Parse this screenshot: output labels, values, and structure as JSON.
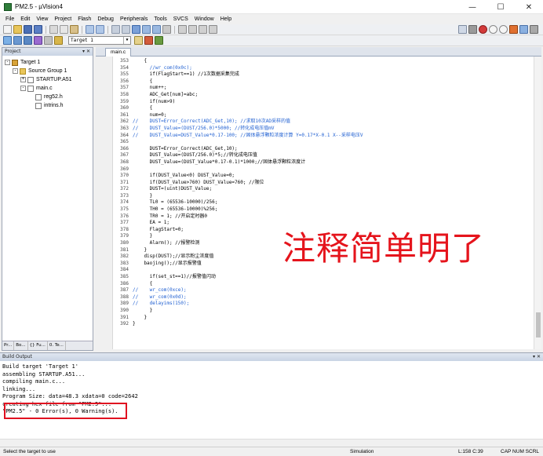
{
  "window": {
    "title": "PM2.5 - µVision4",
    "controls": [
      "—",
      "☐",
      "✕"
    ]
  },
  "menu": [
    "File",
    "Edit",
    "View",
    "Project",
    "Flash",
    "Debug",
    "Peripherals",
    "Tools",
    "SVCS",
    "Window",
    "Help"
  ],
  "toolbar": {
    "target_select": "Target 1"
  },
  "project_panel": {
    "title": "Project",
    "tree": [
      {
        "label": "Target 1",
        "level": 0,
        "kind": "target",
        "expand": "-"
      },
      {
        "label": "Source Group 1",
        "level": 1,
        "kind": "folder",
        "expand": "-"
      },
      {
        "label": "STARTUP.A51",
        "level": 2,
        "kind": "file",
        "expand": "+"
      },
      {
        "label": "main.c",
        "level": 2,
        "kind": "file",
        "expand": "-"
      },
      {
        "label": "reg52.h",
        "level": 3,
        "kind": "file",
        "expand": ""
      },
      {
        "label": "intrins.h",
        "level": 3,
        "kind": "file",
        "expand": ""
      }
    ],
    "tabs": [
      "Pr...",
      "Bo...",
      "{} Fu...",
      "0. Te..."
    ]
  },
  "editor": {
    "tab": "main.c",
    "lines": [
      {
        "n": "353",
        "code": "    {"
      },
      {
        "n": "354",
        "code": "      //wr_com(0x0c);"
      },
      {
        "n": "355",
        "code": "      if(FlagStart==1) //1次数据采集完成"
      },
      {
        "n": "356",
        "code": "      {"
      },
      {
        "n": "357",
        "code": "      num++;"
      },
      {
        "n": "358",
        "code": "      ADC_Get[num]=abc;"
      },
      {
        "n": "359",
        "code": "      if(num>9)"
      },
      {
        "n": "360",
        "code": "      {"
      },
      {
        "n": "361",
        "code": "      num=0;"
      },
      {
        "n": "362",
        "code": "//    DUST=Error_Correct(ADC_Get,10); //求取10次AD采样的值"
      },
      {
        "n": "363",
        "code": "//    DUST_Value=(DUST/256.0)*5000; //转化成电压值mV"
      },
      {
        "n": "364",
        "code": "//    DUST_Value=DUST_Value*0.17-100; //固体悬浮颗粒浓度计算 Y=0.17*X-0.1 X--采样电压V"
      },
      {
        "n": "365",
        "code": ""
      },
      {
        "n": "366",
        "code": "      DUST=Error_Correct(ADC_Get,10);"
      },
      {
        "n": "367",
        "code": "      DUST_Value=(DUST/256.0)*5;//转化成电压值"
      },
      {
        "n": "368",
        "code": "      DUST_Value=(DUST_Value*0.17-0.1)*1000;//固体悬浮颗粒浓度计"
      },
      {
        "n": "369",
        "code": ""
      },
      {
        "n": "370",
        "code": "      if(DUST_Value<0) DUST_Value=0;"
      },
      {
        "n": "371",
        "code": "      if(DUST_Value>760) DUST_Value=760; //限位"
      },
      {
        "n": "372",
        "code": "      DUST=(uint)DUST_Value;"
      },
      {
        "n": "373",
        "code": "      }"
      },
      {
        "n": "374",
        "code": "      TL0 = (65536-10000)/256;"
      },
      {
        "n": "375",
        "code": "      TH0 = (65536-10000)%256;"
      },
      {
        "n": "376",
        "code": "      TR0 = 1; //开启定时器0"
      },
      {
        "n": "377",
        "code": "      EA = 1;"
      },
      {
        "n": "378",
        "code": "      FlagStart=0;"
      },
      {
        "n": "379",
        "code": "      }"
      },
      {
        "n": "380",
        "code": "      Alarm(); //报警检测"
      },
      {
        "n": "381",
        "code": "    }"
      },
      {
        "n": "382",
        "code": "    disp(DUST);//显示粉尘浓度值"
      },
      {
        "n": "383",
        "code": "    baojing();//显示报警值"
      },
      {
        "n": "384",
        "code": ""
      },
      {
        "n": "385",
        "code": "      if(set_st==1)//报警值闪动"
      },
      {
        "n": "386",
        "code": "      {"
      },
      {
        "n": "387",
        "code": "//    wr_com(0xce);"
      },
      {
        "n": "388",
        "code": "//    wr_com(0x0d);"
      },
      {
        "n": "389",
        "code": "//    delayims(150);"
      },
      {
        "n": "390",
        "code": "      }"
      },
      {
        "n": "391",
        "code": "    }"
      },
      {
        "n": "392",
        "code": "}"
      }
    ]
  },
  "annotation": {
    "text": "注释简单明了",
    "color": "#e5141c"
  },
  "build_output": {
    "title": "Build Output",
    "lines": [
      "Build target 'Target 1'",
      "assembling STARTUP.A51...",
      "compiling main.c...",
      "linking...",
      "Program Size: data=48.3 xdata=0 code=2642",
      "creating hex file from \"PM2.5\"...",
      "\"PM2.5\" - 0 Error(s), 0 Warning(s)."
    ]
  },
  "status_bar": {
    "message": "Select the target to use",
    "mode": "Simulation",
    "position": "L:158 C:39",
    "keys": "CAP  NUM  SCRL"
  }
}
